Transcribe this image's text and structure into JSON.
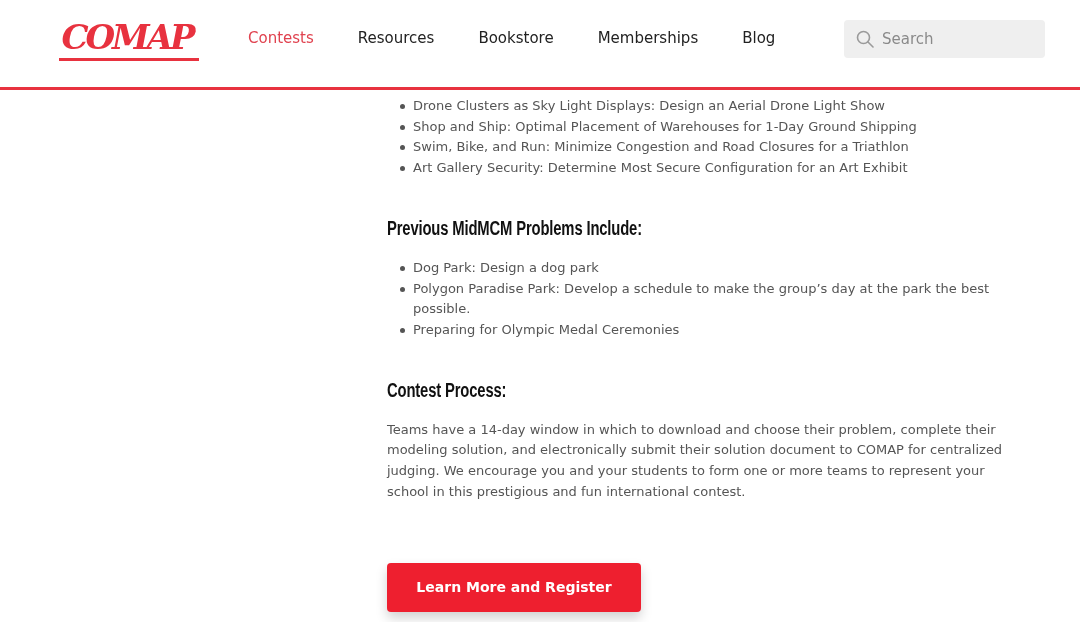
{
  "header": {
    "logo": "COMAP",
    "nav": [
      {
        "label": "Contests",
        "selected": true
      },
      {
        "label": "Resources",
        "selected": false
      },
      {
        "label": "Bookstore",
        "selected": false
      },
      {
        "label": "Memberships",
        "selected": false
      },
      {
        "label": "Blog",
        "selected": false
      }
    ],
    "search": {
      "placeholder": "Search"
    }
  },
  "sections": [
    {
      "kind": "list",
      "items": [
        "Drone Clusters as Sky Light Displays: Design an Aerial Drone Light Show",
        "Shop and Ship: Optimal Placement of Warehouses for 1-Day Ground Shipping",
        "Swim, Bike, and Run: Minimize Congestion and Road Closures for a Triathlon",
        "Art Gallery Security: Determine Most Secure Configuration for an Art Exhibit"
      ]
    },
    {
      "kind": "heading",
      "text": "Previous MidMCM Problems Include:"
    },
    {
      "kind": "list",
      "items": [
        "Dog Park: Design a dog park",
        "Polygon Paradise Park: Develop a schedule to make the group’s day at the park the best possible.",
        "Preparing for Olympic Medal Ceremonies"
      ]
    },
    {
      "kind": "heading",
      "text": "Contest Process:"
    },
    {
      "kind": "paragraph",
      "text": "Teams have a 14-day window in which to download and choose their problem, complete their modeling solution, and electronically submit their solution document to COMAP for centralized judging. We encourage you and your students to form one or more teams to represent your school in this prestigious and fun international contest."
    },
    {
      "kind": "button",
      "label": "Learn More and Register"
    }
  ]
}
